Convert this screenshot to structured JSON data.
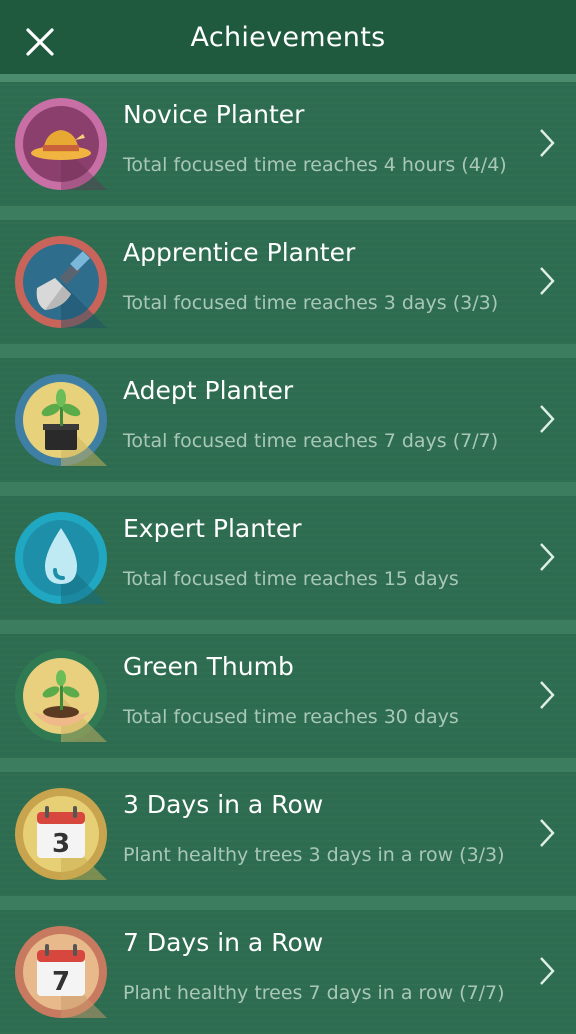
{
  "header": {
    "title": "Achievements",
    "close_icon": "close-icon"
  },
  "achievements": [
    {
      "title": "Novice Planter",
      "subtitle": "Total focused time reaches 4 hours (4/4)",
      "icon": "straw-hat-icon",
      "ring_color": "#c86fa6",
      "fill_color": "#8a3f6c"
    },
    {
      "title": "Apprentice Planter",
      "subtitle": "Total focused time reaches 3 days (3/3)",
      "icon": "trowel-icon",
      "ring_color": "#c9645b",
      "fill_color": "#2f6d8c"
    },
    {
      "title": "Adept Planter",
      "subtitle": "Total focused time reaches 7 days (7/7)",
      "icon": "potted-plant-icon",
      "ring_color": "#3f7fa3",
      "fill_color": "#e7d17b"
    },
    {
      "title": "Expert Planter",
      "subtitle": "Total focused time reaches 15 days",
      "icon": "water-drop-icon",
      "ring_color": "#20a7c2",
      "fill_color": "#1e8fa9"
    },
    {
      "title": "Green Thumb",
      "subtitle": "Total focused time reaches 30 days",
      "icon": "seedling-hands-icon",
      "ring_color": "#2f7a52",
      "fill_color": "#e9d07f"
    },
    {
      "title": "3 Days in a Row",
      "subtitle": "Plant healthy trees 3 days in a row (3/3)",
      "icon": "calendar-3-icon",
      "ring_color": "#c9a44e",
      "fill_color": "#e6cf74",
      "calendar_number": "3"
    },
    {
      "title": "7 Days in a Row",
      "subtitle": "Plant healthy trees 7 days in a row  (7/7)",
      "icon": "calendar-7-icon",
      "ring_color": "#c77a5f",
      "fill_color": "#e7b98b",
      "calendar_number": "7"
    }
  ]
}
